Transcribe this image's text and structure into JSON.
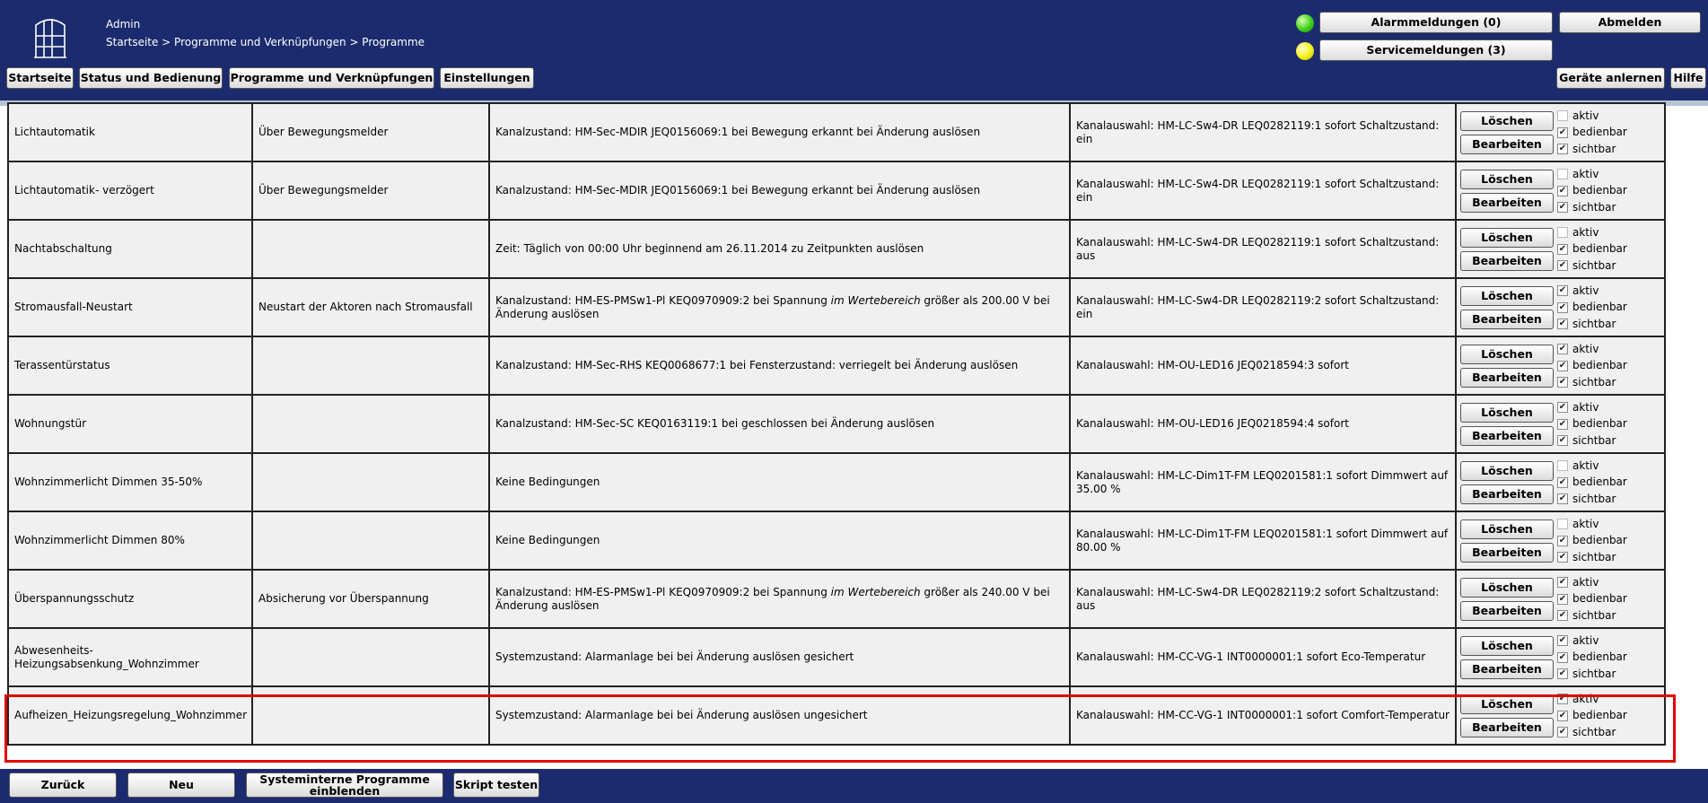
{
  "header": {
    "user": "Admin",
    "breadcrumb": "Startseite > Programme und Verknüpfungen > Programme",
    "alarm_button": "Alarmmeldungen (0)",
    "service_button": "Servicemeldungen (3)",
    "logout_button": "Abmelden",
    "nav": [
      "Startseite",
      "Status und Bedienung",
      "Programme und Verknüpfungen",
      "Einstellungen"
    ],
    "teach_button": "Geräte anlernen",
    "help_button": "Hilfe",
    "alarm_indicator_color": "#3ecf1a",
    "service_indicator_color": "#f1ef14"
  },
  "row_actions": {
    "delete": "Löschen",
    "edit": "Bearbeiten",
    "active": "aktiv",
    "operable": "bedienbar",
    "visible": "sichtbar"
  },
  "programs": [
    {
      "name": "Lichtautomatik",
      "description": "Über Bewegungsmelder",
      "condition": "Kanalzustand: HM-Sec-MDIR JEQ0156069:1 bei Bewegung erkannt bei Änderung auslösen",
      "condition_em": "",
      "condition_rest": "",
      "activity": "Kanalauswahl: HM-LC-Sw4-DR LEQ0282119:1 sofort Schaltzustand: ein",
      "active": false,
      "operable": true,
      "visible": true
    },
    {
      "name": "Lichtautomatik- verzögert",
      "description": "Über Bewegungsmelder",
      "condition": "Kanalzustand: HM-Sec-MDIR JEQ0156069:1 bei Bewegung erkannt bei Änderung auslösen",
      "condition_em": "",
      "condition_rest": "",
      "activity": "Kanalauswahl: HM-LC-Sw4-DR LEQ0282119:1 sofort Schaltzustand: ein",
      "active": false,
      "operable": true,
      "visible": true
    },
    {
      "name": "Nachtabschaltung",
      "description": "",
      "condition": "Zeit: Täglich von 00:00 Uhr beginnend am 26.11.2014 zu Zeitpunkten auslösen",
      "condition_em": "",
      "condition_rest": "",
      "activity": "Kanalauswahl: HM-LC-Sw4-DR LEQ0282119:1 sofort Schaltzustand: aus",
      "active": false,
      "operable": true,
      "visible": true
    },
    {
      "name": "Stromausfall-Neustart",
      "description": "Neustart der Aktoren nach Stromausfall",
      "condition": "Kanalzustand: HM-ES-PMSw1-Pl KEQ0970909:2 bei Spannung ",
      "condition_em": "im Wertebereich",
      "condition_rest": " größer als 200.00 V bei Änderung auslösen",
      "activity": "Kanalauswahl: HM-LC-Sw4-DR LEQ0282119:2 sofort Schaltzustand: ein",
      "active": true,
      "operable": true,
      "visible": true
    },
    {
      "name": "Terassentürstatus",
      "description": "",
      "condition": "Kanalzustand: HM-Sec-RHS KEQ0068677:1 bei Fensterzustand: verriegelt bei Änderung auslösen",
      "condition_em": "",
      "condition_rest": "",
      "activity": "Kanalauswahl: HM-OU-LED16 JEQ0218594:3 sofort",
      "active": true,
      "operable": true,
      "visible": true
    },
    {
      "name": "Wohnungstür",
      "description": "",
      "condition": "Kanalzustand: HM-Sec-SC KEQ0163119:1 bei geschlossen bei Änderung auslösen",
      "condition_em": "",
      "condition_rest": "",
      "activity": "Kanalauswahl: HM-OU-LED16 JEQ0218594:4 sofort",
      "active": true,
      "operable": true,
      "visible": true
    },
    {
      "name": "Wohnzimmerlicht Dimmen 35-50%",
      "description": "",
      "condition": "Keine Bedingungen",
      "condition_em": "",
      "condition_rest": "",
      "activity": "Kanalauswahl: HM-LC-Dim1T-FM LEQ0201581:1 sofort Dimmwert auf 35.00 %",
      "active": false,
      "operable": true,
      "visible": true
    },
    {
      "name": "Wohnzimmerlicht Dimmen 80%",
      "description": "",
      "condition": "Keine Bedingungen",
      "condition_em": "",
      "condition_rest": "",
      "activity": "Kanalauswahl: HM-LC-Dim1T-FM LEQ0201581:1 sofort Dimmwert auf 80.00 %",
      "active": false,
      "operable": true,
      "visible": true
    },
    {
      "name": "Überspannungsschutz",
      "description": "Absicherung vor Überspannung",
      "condition": "Kanalzustand: HM-ES-PMSw1-Pl KEQ0970909:2 bei Spannung ",
      "condition_em": "im Wertebereich",
      "condition_rest": " größer als 240.00 V bei Änderung auslösen",
      "activity": "Kanalauswahl: HM-LC-Sw4-DR LEQ0282119:2 sofort Schaltzustand: aus",
      "active": true,
      "operable": true,
      "visible": true
    },
    {
      "name": "Abwesenheits-Heizungsabsenkung_Wohnzimmer",
      "description": "",
      "condition": "Systemzustand: Alarmanlage bei bei Änderung auslösen gesichert",
      "condition_em": "",
      "condition_rest": "",
      "activity": "Kanalauswahl: HM-CC-VG-1 INT0000001:1 sofort Eco-Temperatur",
      "active": true,
      "operable": true,
      "visible": true
    },
    {
      "name": "Aufheizen_Heizungsregelung_Wohnzimmer",
      "description": "",
      "condition": "Systemzustand: Alarmanlage bei bei Änderung auslösen ungesichert",
      "condition_em": "",
      "condition_rest": "",
      "activity": "Kanalauswahl: HM-CC-VG-1 INT0000001:1 sofort Comfort-Temperatur",
      "active": true,
      "operable": true,
      "visible": true
    }
  ],
  "footer": {
    "back": "Zurück",
    "new": "Neu",
    "system_programs": "Systeminterne Programme einblenden",
    "test_script": "Skript testen"
  },
  "highlight_color": "#e00000"
}
